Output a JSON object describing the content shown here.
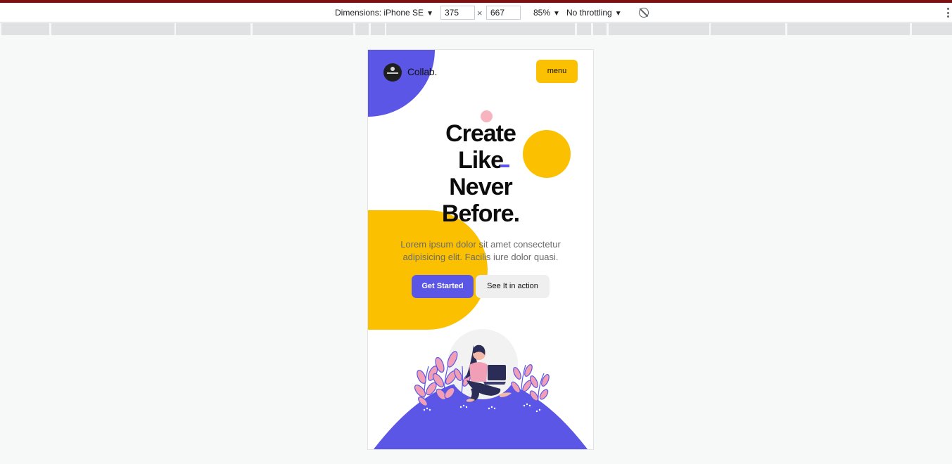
{
  "devtools": {
    "dimensions_label": "Dimensions: iPhone SE",
    "width_value": "375",
    "height_value": "667",
    "times_symbol": "×",
    "zoom": "85%",
    "throttling": "No throttling",
    "arrow": "▼"
  },
  "site": {
    "logo_text": "Collab.",
    "menu_label": "menu",
    "headline": [
      "Create",
      "Like",
      "Never",
      "Before."
    ],
    "subtext": "Lorem ipsum dolor sit amet consectetur adipisicing elit. Facilis iure dolor quasi.",
    "cta_primary": "Get Started",
    "cta_secondary": "See It in action"
  },
  "colors": {
    "accent_purple": "#5b56e6",
    "accent_yellow": "#fbc000",
    "accent_pink": "#f7b4c0",
    "devtools_topline": "#7d1010"
  }
}
